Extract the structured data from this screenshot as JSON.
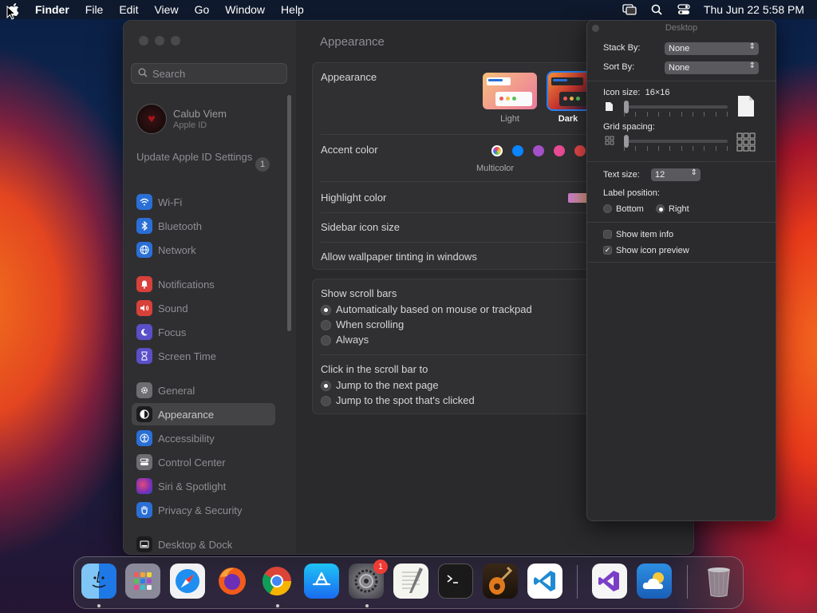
{
  "menubar": {
    "app": "Finder",
    "menus": [
      "File",
      "Edit",
      "View",
      "Go",
      "Window",
      "Help"
    ],
    "clock": "Thu Jun 22  5:58 PM"
  },
  "sidebar": {
    "search_placeholder": "Search",
    "profile": {
      "name": "Calub Viem",
      "subtitle": "Apple ID"
    },
    "update": {
      "label": "Update Apple ID Settings",
      "badge": "1"
    },
    "items": [
      {
        "label": "Wi-Fi",
        "icon": "wifi-icon",
        "color": "#2a6fd6"
      },
      {
        "label": "Bluetooth",
        "icon": "bluetooth-icon",
        "color": "#2a6fd6"
      },
      {
        "label": "Network",
        "icon": "globe-icon",
        "color": "#2a6fd6"
      },
      {
        "label": "Notifications",
        "icon": "bell-icon",
        "color": "#d8403a"
      },
      {
        "label": "Sound",
        "icon": "speaker-icon",
        "color": "#d8403a"
      },
      {
        "label": "Focus",
        "icon": "moon-icon",
        "color": "#5b4fc9"
      },
      {
        "label": "Screen Time",
        "icon": "hourglass-icon",
        "color": "#5b4fc9"
      },
      {
        "label": "General",
        "icon": "gear-icon",
        "color": "#6e6e72"
      },
      {
        "label": "Appearance",
        "icon": "appearance-icon",
        "color": "#1c1c1e"
      },
      {
        "label": "Accessibility",
        "icon": "accessibility-icon",
        "color": "#2a6fd6"
      },
      {
        "label": "Control Center",
        "icon": "control-center-icon",
        "color": "#6e6e72"
      },
      {
        "label": "Siri & Spotlight",
        "icon": "siri-icon",
        "color": "#b03a8c"
      },
      {
        "label": "Privacy & Security",
        "icon": "hand-icon",
        "color": "#2a6fd6"
      },
      {
        "label": "Desktop & Dock",
        "icon": "dock-icon",
        "color": "#1c1c1e"
      }
    ]
  },
  "main": {
    "title": "Appearance",
    "appearance_label": "Appearance",
    "appearance_options": [
      "Light",
      "Dark"
    ],
    "accent_label": "Accent color",
    "accent_caption": "Multicolor",
    "accent_colors": [
      "#0a84ff",
      "#a550c8",
      "#e84a93",
      "#e8484a"
    ],
    "highlight_label": "Highlight color",
    "sidebar_icon_label": "Sidebar icon size",
    "tinting_label": "Allow wallpaper tinting in windows",
    "scroll_title": "Show scroll bars",
    "scroll_options": [
      "Automatically based on mouse or trackpad",
      "When scrolling",
      "Always"
    ],
    "click_title": "Click in the scroll bar to",
    "click_options": [
      "Jump to the next page",
      "Jump to the spot that's clicked"
    ]
  },
  "desktop_panel": {
    "title": "Desktop",
    "stack_by_label": "Stack By:",
    "stack_by_value": "None",
    "sort_by_label": "Sort By:",
    "sort_by_value": "None",
    "icon_size_label": "Icon size:",
    "icon_size_value": "16×16",
    "grid_spacing_label": "Grid spacing:",
    "text_size_label": "Text size:",
    "text_size_value": "12",
    "label_position_label": "Label position:",
    "label_position_options": [
      "Bottom",
      "Right"
    ],
    "show_item_info": "Show item info",
    "show_icon_preview": "Show icon preview"
  },
  "dock": {
    "apps": [
      {
        "name": "finder-icon",
        "color": "#1e78e6"
      },
      {
        "name": "launchpad-icon",
        "color": "#8a8a9a"
      },
      {
        "name": "safari-icon",
        "color": "#1e8ef0"
      },
      {
        "name": "firefox-icon",
        "color": "#f25b1c"
      },
      {
        "name": "chrome-icon",
        "color": "#34a853"
      },
      {
        "name": "app-store-icon",
        "color": "#1a7cf5"
      },
      {
        "name": "system-settings-icon",
        "color": "#6b6b70"
      },
      {
        "name": "textedit-icon",
        "color": "#f2f2f2"
      },
      {
        "name": "terminal-icon",
        "color": "#1a1a1a"
      },
      {
        "name": "garageband-icon",
        "color": "#e07a1c"
      },
      {
        "name": "vscode-icon",
        "color": "#ffffff"
      },
      {
        "name": "visual-studio-icon",
        "color": "#f5f5f5"
      },
      {
        "name": "weather-icon",
        "color": "#2d8fe3"
      },
      {
        "name": "trash-icon",
        "color": "#9a9aa0"
      }
    ],
    "settings_badge": "1"
  }
}
